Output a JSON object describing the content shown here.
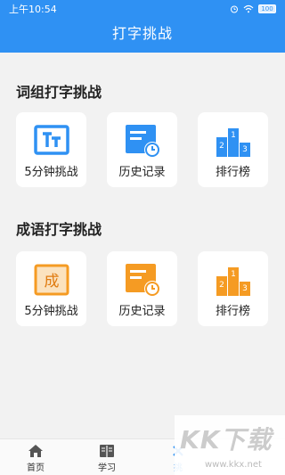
{
  "status": {
    "time": "上午10:54",
    "battery": "100"
  },
  "header": {
    "title": "打字挑战"
  },
  "sections": [
    {
      "title": "词组打字挑战",
      "cards": [
        {
          "label": "5分钟挑战",
          "icon": "tt-text-icon"
        },
        {
          "label": "历史记录",
          "icon": "history-clock-icon"
        },
        {
          "label": "排行榜",
          "icon": "podium-ranking-icon"
        }
      ]
    },
    {
      "title": "成语打字挑战",
      "cards": [
        {
          "label": "5分钟挑战",
          "icon": "cheng-char-icon",
          "icon_text": "成"
        },
        {
          "label": "历史记录",
          "icon": "history-clock-icon"
        },
        {
          "label": "排行榜",
          "icon": "podium-ranking-icon"
        }
      ]
    }
  ],
  "tabs": [
    {
      "label": "首页",
      "icon": "home-icon"
    },
    {
      "label": "学习",
      "icon": "book-icon"
    },
    {
      "label": "挑",
      "icon": "challenge-icon",
      "active": true
    }
  ],
  "watermark": {
    "logo": "KK下载",
    "url": "www.kkx.net"
  },
  "colors": {
    "primary": "#2f91f3",
    "secondary": "#f59b23",
    "background": "#f2f2f2"
  }
}
